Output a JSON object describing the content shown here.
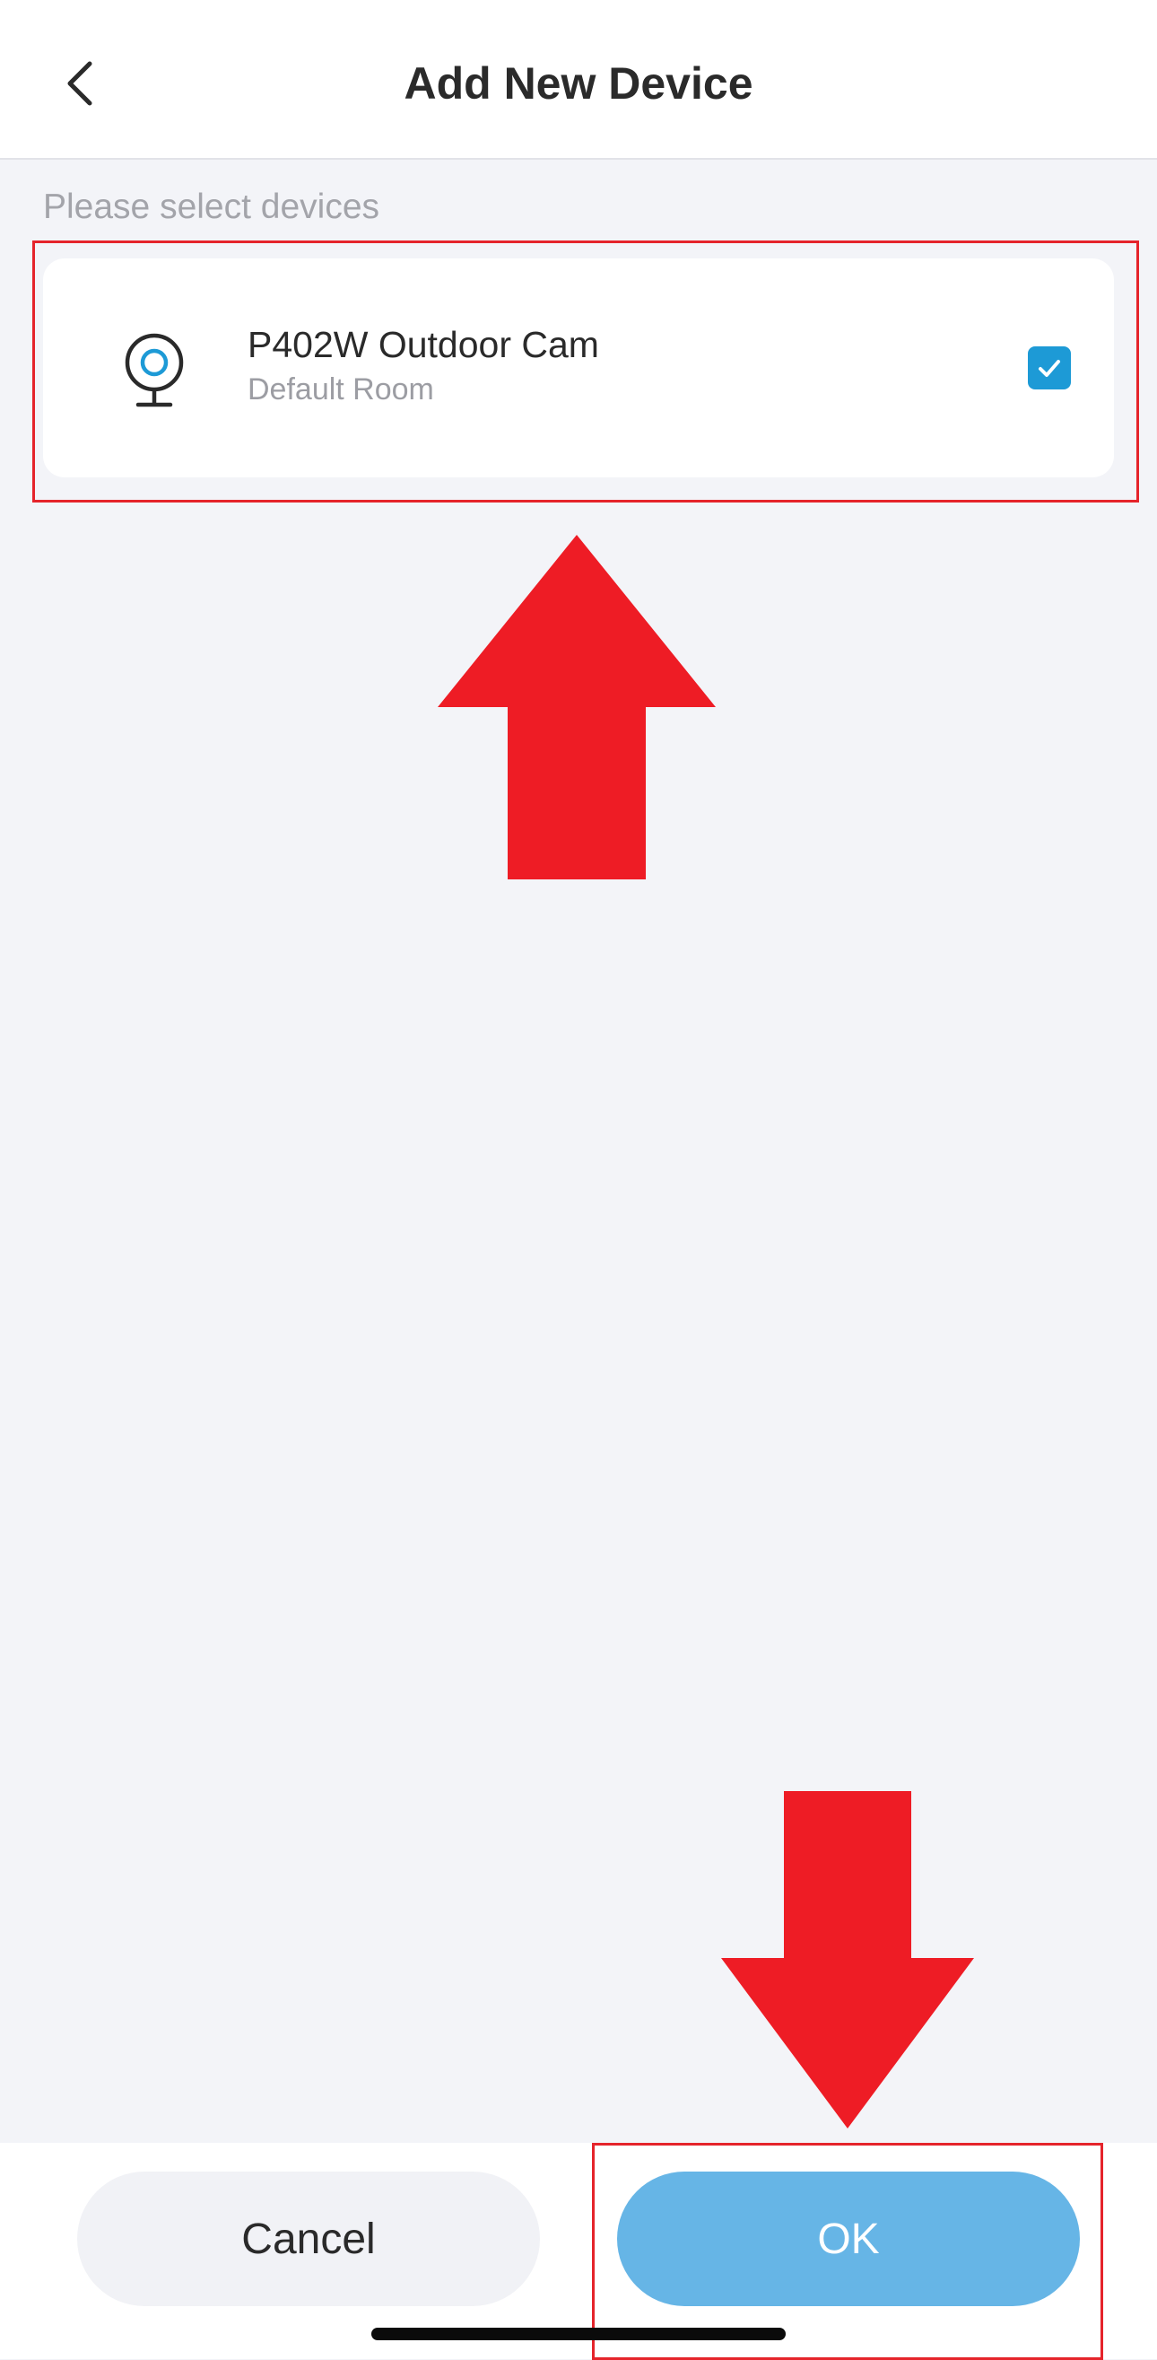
{
  "header": {
    "title": "Add New Device",
    "back_icon": "chevron-left-icon"
  },
  "section": {
    "label": "Please select devices"
  },
  "devices": [
    {
      "name": "P402W Outdoor Cam",
      "room": "Default Room",
      "icon": "camera-icon",
      "selected": true
    }
  ],
  "buttons": {
    "cancel_label": "Cancel",
    "ok_label": "OK"
  },
  "colors": {
    "accent": "#1d9ad6",
    "ok_button": "#66b5e6",
    "annotation_red": "#ee1c25",
    "background": "#f3f4f8"
  }
}
